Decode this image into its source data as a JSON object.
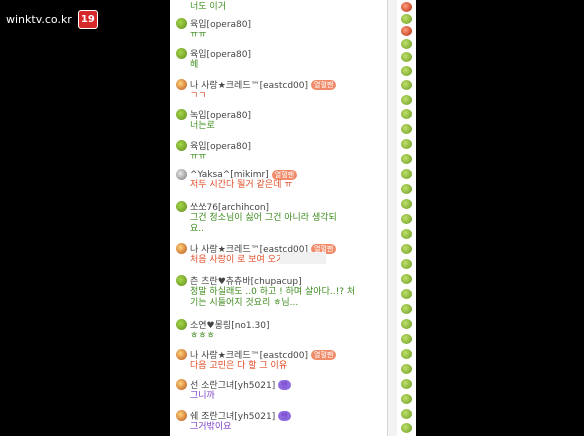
{
  "watermark": {
    "site": "winktv.co.kr",
    "age": "19"
  },
  "messages": [
    {
      "avatar": "turtle",
      "user": "",
      "text": "너도 이거",
      "color": "green"
    },
    {
      "avatar": "turtle",
      "user": "육입[opera80]",
      "text": "ㅠㅠ",
      "color": "green"
    },
    {
      "avatar": "turtle",
      "user": "육입[opera80]",
      "text": "헤",
      "color": "green"
    },
    {
      "avatar": "gem",
      "user": "나 사랑★크레드™[eastcd00]",
      "badge": "열혈팬",
      "text": "ㄱㄱ",
      "color": "red"
    },
    {
      "avatar": "turtle",
      "user": "녹입[opera80]",
      "text": "너는로",
      "color": "green"
    },
    {
      "avatar": "turtle",
      "user": "육입[opera80]",
      "text": "ㅠㅠ",
      "color": "green"
    },
    {
      "avatar": "face",
      "user": "^Yaksa^[mikimr]",
      "badge": "열혈팬",
      "text": "저두 시간다 될거 같은데 ㅠ",
      "color": "red"
    },
    {
      "avatar": "turtle",
      "user": "쏘쏘76[archihcon]",
      "text": "그건 청소님이 싫어 그건 아니라 생각되\n요..",
      "color": "green"
    },
    {
      "avatar": "gem",
      "user": "나 사랑★크레드™[eastcd00]",
      "badge": "열혈팬",
      "text": "처음 사랑이 로 보여 오기...",
      "color": "red"
    },
    {
      "avatar": "turtle",
      "user": "츤 츠란♥츄츄바[chupacup]",
      "text": "정말 하실래도 ..0 하고 ! 하며 살아다..!? 처\n기는 시들어지 것요리 ㅎ님...",
      "color": "green"
    },
    {
      "avatar": "turtle",
      "user": "소연♥몽링[no1.30]",
      "text": "ㅎㅎㅎ",
      "color": "green"
    },
    {
      "avatar": "gem",
      "user": "나 사랑★크레드™[eastcd00]",
      "badge": "열혈팬",
      "text": "다음 고민은 다 할 그 이유",
      "color": "red"
    },
    {
      "avatar": "gem",
      "user": "선 소란그녀[yh5021]",
      "badge": "팬",
      "text": "그니까",
      "color": "purple"
    },
    {
      "avatar": "gem",
      "user": "쉐 조란그녀[yh5021]",
      "badge": "팬",
      "text": "그거밖이요",
      "color": "purple"
    }
  ]
}
